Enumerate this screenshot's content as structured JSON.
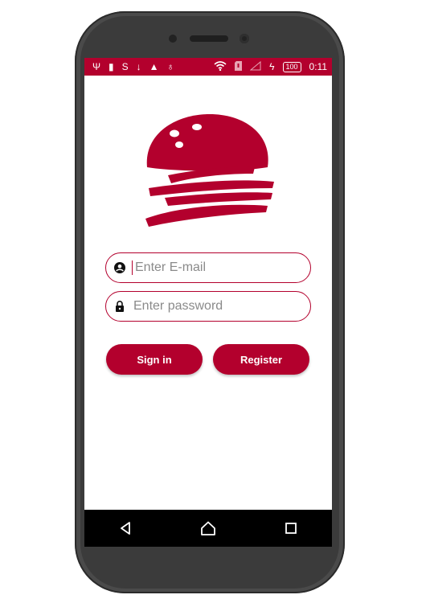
{
  "status_bar": {
    "icons": [
      "usb-icon",
      "phone-icon",
      "s-icon",
      "download-icon",
      "warning-icon",
      "android-icon",
      "wifi-icon",
      "sim-icon",
      "signal-icon",
      "charging-icon"
    ],
    "battery_level": "100",
    "time": "0:11"
  },
  "login": {
    "email_placeholder": "Enter E-mail",
    "password_placeholder": "Enter password",
    "signin_label": "Sign in",
    "register_label": "Register"
  },
  "theme": {
    "primary": "#b3002d",
    "background": "#ffffff",
    "nav_bar": "#000000"
  },
  "nav": {
    "buttons": [
      "back-icon",
      "home-icon",
      "recents-icon"
    ]
  }
}
